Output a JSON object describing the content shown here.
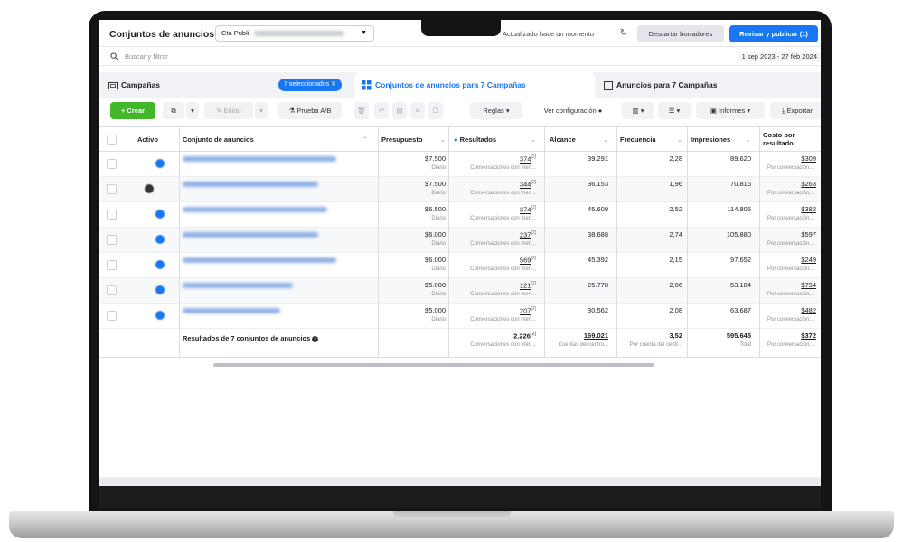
{
  "topbar": {
    "title": "Conjuntos de anuncios",
    "account_label": "Cta Publi",
    "updated": "Actualizado hace un momento",
    "discard": "Descartar borradores",
    "publish": "Revisar y publicar (1)"
  },
  "search": {
    "placeholder": "Buscar y filtrar",
    "date_range": "1 sep 2023 - 27 feb 2024"
  },
  "tabs": {
    "campaigns": "Campañas",
    "selected_pill": "7 seleccionados",
    "adsets": "Conjuntos de anuncios para 7 Campañas",
    "ads": "Anuncios para 7 Campañas"
  },
  "toolbar": {
    "create": "+ Crear",
    "edit": "Editar",
    "ab_test": "Prueba A/B",
    "rules": "Reglas",
    "view_config": "Ver configuración",
    "reports": "Informes",
    "export": "Exportar"
  },
  "columns": {
    "active": "Activo",
    "adset": "Conjunto de anuncios",
    "budget": "Presupuesto",
    "results": "Resultados",
    "reach": "Alcance",
    "frequency": "Frecuencia",
    "impressions": "Impresiones",
    "cost_per_result": "Costo por resultado"
  },
  "rows": [
    {
      "status": "on",
      "budget": "$7.500",
      "budget_period": "Diario",
      "results": "374",
      "results_sub": "Conversaciones con men...",
      "reach": "39.291",
      "frequency": "2,28",
      "impressions": "89.620",
      "cost": "$309",
      "cost_sub": "Por conversación..."
    },
    {
      "status": "off",
      "budget": "$7.500",
      "budget_period": "Diario",
      "results": "344",
      "results_sub": "Conversaciones con men...",
      "reach": "36.153",
      "frequency": "1,96",
      "impressions": "70.816",
      "cost": "$263",
      "cost_sub": "Por conversación..."
    },
    {
      "status": "on",
      "budget": "$6.500",
      "budget_period": "Diario",
      "results": "374",
      "results_sub": "Conversaciones con men...",
      "reach": "45.609",
      "frequency": "2,52",
      "impressions": "114.806",
      "cost": "$382",
      "cost_sub": "Por conversación..."
    },
    {
      "status": "on",
      "budget": "$6.000",
      "budget_period": "Diario",
      "results": "237",
      "results_sub": "Conversaciones con men...",
      "reach": "38.688",
      "frequency": "2,74",
      "impressions": "105.880",
      "cost": "$597",
      "cost_sub": "Por conversación..."
    },
    {
      "status": "on",
      "budget": "$6.000",
      "budget_period": "Diario",
      "results": "569",
      "results_sub": "Conversaciones con men...",
      "reach": "45.392",
      "frequency": "2,15",
      "impressions": "97.652",
      "cost": "$249",
      "cost_sub": "Por conversación..."
    },
    {
      "status": "on",
      "budget": "$5.000",
      "budget_period": "Diario",
      "results": "121",
      "results_sub": "Conversaciones con men...",
      "reach": "25.778",
      "frequency": "2,06",
      "impressions": "53.184",
      "cost": "$794",
      "cost_sub": "Por conversación..."
    },
    {
      "status": "on",
      "budget": "$5.000",
      "budget_period": "Diario",
      "results": "207",
      "results_sub": "Conversaciones con men...",
      "reach": "30.562",
      "frequency": "2,08",
      "impressions": "63.687",
      "cost": "$482",
      "cost_sub": "Por conversación..."
    }
  ],
  "summary": {
    "label": "Resultados de 7 conjuntos de anuncios",
    "results": "2.226",
    "results_sub": "Conversaciones con men...",
    "reach": "169.021",
    "reach_sub": "Cuentas del centro...",
    "frequency": "3,52",
    "frequency_sub": "Por cuenta del centr...",
    "impressions": "595.645",
    "impressions_sub": "Total",
    "cost": "$372",
    "cost_sub": "Por conversación..."
  },
  "colors": {
    "brand_blue": "#1877f2",
    "create_green": "#42b72a"
  }
}
